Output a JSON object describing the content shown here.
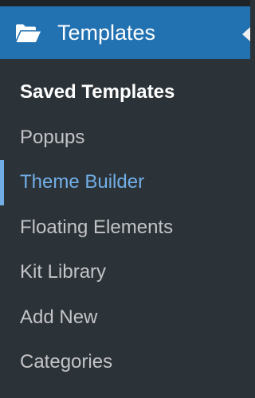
{
  "menu": {
    "title": "Templates",
    "icon": "folder-open-icon",
    "colors": {
      "background": "#2c3338",
      "header": "#2271b1",
      "text": "#c3c4c7",
      "active_text": "#ffffff",
      "hover_text": "#72aee6"
    },
    "items": [
      {
        "label": "Saved Templates",
        "state": "current"
      },
      {
        "label": "Popups",
        "state": "normal"
      },
      {
        "label": "Theme Builder",
        "state": "hover"
      },
      {
        "label": "Floating Elements",
        "state": "normal"
      },
      {
        "label": "Kit Library",
        "state": "normal"
      },
      {
        "label": "Add New",
        "state": "normal"
      },
      {
        "label": "Categories",
        "state": "normal"
      }
    ]
  }
}
